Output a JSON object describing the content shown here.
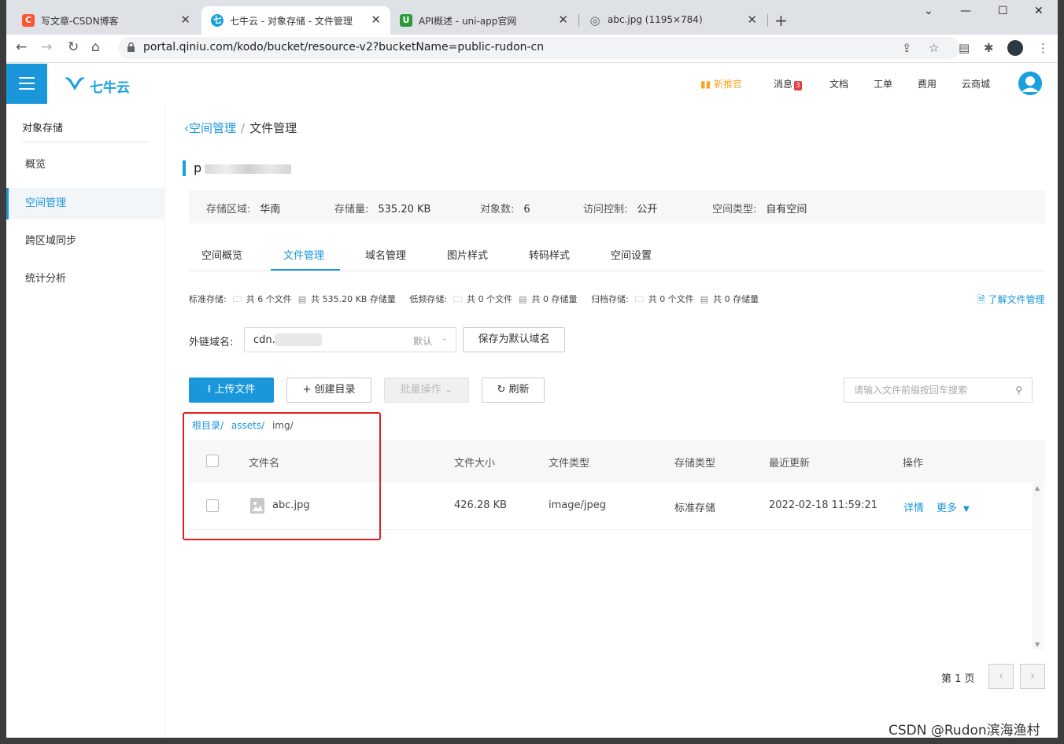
{
  "browser": {
    "tabs": [
      {
        "icon": "C",
        "icon_color": "#fc5531",
        "title": "写文章-CSDN博客"
      },
      {
        "icon": "七",
        "icon_color": "#19a1dd",
        "title": "七牛云 - 对象存储 - 文件管理"
      },
      {
        "icon": "U",
        "icon_color": "#2b9939",
        "title": "API概述 - uni-app官网"
      },
      {
        "icon": "◎",
        "icon_color": "#5f6368",
        "title": "abc.jpg (1195×784)"
      }
    ],
    "close_glyph": "✕",
    "new_tab_glyph": "+",
    "url": "portal.qiniu.com/kodo/bucket/resource-v2?bucketName=public-rudon-cn"
  },
  "header": {
    "logo_text": "七牛云",
    "promo": "新推官",
    "nav": {
      "messages": "消息",
      "messages_count": "3",
      "docs": "文档",
      "tickets": "工单",
      "billing": "费用",
      "market": "云商城"
    }
  },
  "sidebar": {
    "title": "对象存储",
    "items": [
      {
        "label": "概览"
      },
      {
        "label": "空间管理"
      },
      {
        "label": "跨区域同步"
      },
      {
        "label": "统计分析"
      }
    ]
  },
  "breadcrumb": {
    "back": "空间管理",
    "sep": "/",
    "current": "文件管理"
  },
  "bucket": {
    "name_visible": "p"
  },
  "info": {
    "region_label": "存储区域:",
    "region": "华南",
    "storage_label": "存储量:",
    "storage": "535.20 KB",
    "objects_label": "对象数:",
    "objects": "6",
    "access_label": "访问控制:",
    "access": "公开",
    "type_label": "空间类型:",
    "type": "自有空间"
  },
  "tabs": [
    "空间概览",
    "文件管理",
    "域名管理",
    "图片样式",
    "转码样式",
    "空间设置"
  ],
  "stats": {
    "standard_label": "标准存储:",
    "standard_files": "共 6 个文件",
    "standard_size": "共 535.20 KB 存储量",
    "infrequent_label": "低频存储:",
    "infrequent_files": "共 0 个文件",
    "infrequent_size": "共 0 存储量",
    "archive_label": "归档存储:",
    "archive_files": "共 0 个文件",
    "archive_size": "共 0 存储量",
    "learn_more": "了解文件管理"
  },
  "domain": {
    "label": "外链域名:",
    "value": "cdn.r",
    "default_tag": "默认",
    "save_button": "保存为默认域名"
  },
  "actions": {
    "upload": "上传文件",
    "mkdir": "创建目录",
    "batch": "批量操作",
    "refresh": "刷新",
    "search_placeholder": "请输入文件前缀按回车搜索"
  },
  "path": {
    "root": "根目录/",
    "assets": "assets/",
    "current": "img/"
  },
  "table": {
    "headers": [
      "文件名",
      "文件大小",
      "文件类型",
      "存储类型",
      "最近更新",
      "操作"
    ],
    "rows": [
      {
        "name": "abc.jpg",
        "size": "426.28 KB",
        "mime": "image/jpeg",
        "storage": "标准存储",
        "updated": "2022-02-18 11:59:21",
        "detail": "详情",
        "more": "更多"
      }
    ]
  },
  "pager": {
    "text": "第 1 页",
    "prev": "‹",
    "next": "›"
  },
  "watermark": "CSDN @Rudon滨海渔村"
}
